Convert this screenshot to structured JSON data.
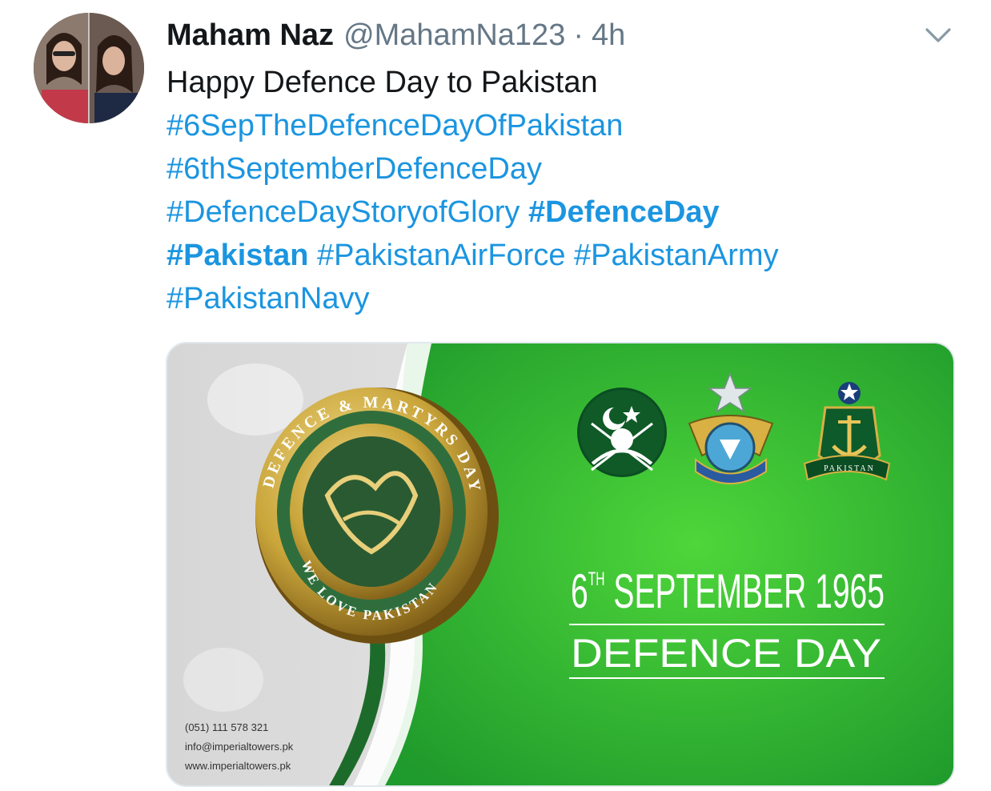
{
  "tweet": {
    "author_name": "Maham Naz",
    "handle": "@MahamNa123",
    "separator": "·",
    "time": "4h",
    "text_line1": "Happy Defence Day to Pakistan",
    "hashtags": [
      "#6SepTheDefenceDayOfPakistan",
      "#6thSeptemberDefenceDay",
      "#DefenceDayStoryofGlory",
      "#DefenceDay",
      "#Pakistan",
      "#PakistanAirForce",
      "#PakistanArmy",
      "#PakistanNavy"
    ]
  },
  "media": {
    "medal_ring_text": "DEFENCE & MARTYRS DAY",
    "medal_bottom_text": "WE LOVE PAKISTAN",
    "date_line_prefix": "6",
    "date_line_sup": "TH",
    "date_line_rest": " SEPTEMBER 1965",
    "title": "DEFENCE DAY",
    "contact_phone": "(051) 111 578 321",
    "contact_email": "info@imperialtowers.pk",
    "contact_web": "www.imperialtowers.pk",
    "navy_ribbon": "PAKISTAN"
  },
  "colors": {
    "link": "#1b95e0",
    "green": "#2fb83a",
    "dark_green": "#1d6b2a",
    "gold": "#c9a53a"
  }
}
